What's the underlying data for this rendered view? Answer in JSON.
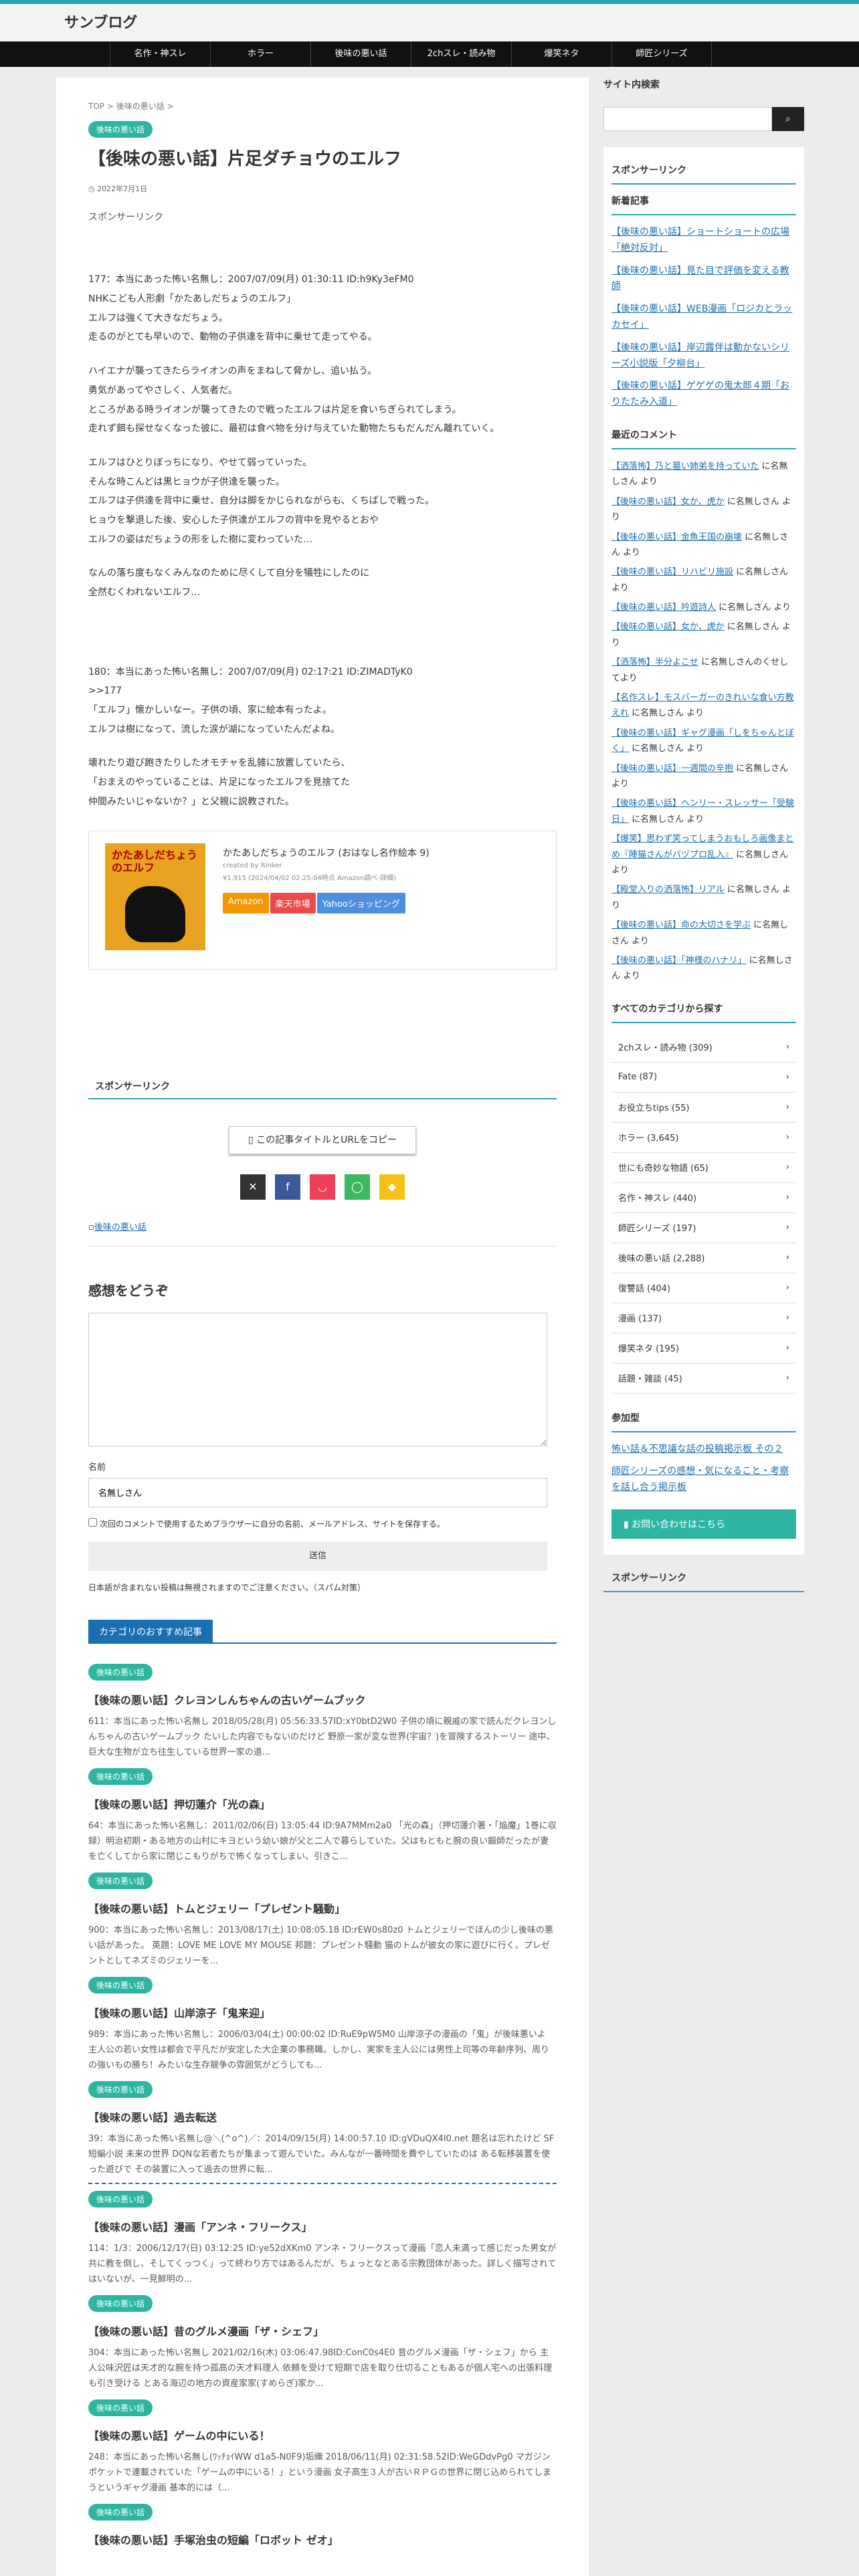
{
  "site": {
    "title": "サンブログ"
  },
  "nav": [
    "名作・神スレ",
    "ホラー",
    "後味の悪い話",
    "2chスレ・読み物",
    "爆笑ネタ",
    "師匠シリーズ"
  ],
  "breadcrumb": "TOP > 後味の悪い話 >",
  "category": "後味の悪い話",
  "post": {
    "title": "【後味の悪い話】片足ダチョウのエルフ",
    "date": "2022年7月1日",
    "sponsor": "スポンサーリンク",
    "blocks": [
      [
        "177：本当にあった怖い名無し：2007/07/09(月) 01:30:11 ID:h9Ky3eFM0",
        "NHKこども人形劇「かたあしだちょうのエルフ」",
        "エルフは強くて大きなだちょう。",
        "走るのがとても早いので、動物の子供達を背中に乗せて走ってやる。"
      ],
      [
        "ハイエナが襲ってきたらライオンの声をまねして脅かし、追い払う。",
        "勇気があってやさしく、人気者だ。",
        "ところがある時ライオンが襲ってきたので戦ったエルフは片足を食いちぎられてしまう。",
        "走れず餌も探せなくなった彼に、最初は食べ物を分け与えていた動物たちもだんだん離れていく。"
      ],
      [
        "エルフはひとりぼっちになり、やせて弱っていった。",
        "そんな時こんどは黒ヒョウが子供達を襲った。",
        "エルフは子供達を背中に乗せ、自分は脚をかじられながらも、くちばしで戦った。",
        "ヒョウを撃退した後、安心した子供達がエルフの背中を見やるとおや",
        "エルフの姿はだちょうの形をした樹に変わっていた…"
      ],
      [
        "なんの落ち度もなくみんなのために尽くして自分を犠牲にしたのに",
        "全然むくわれないエルフ…"
      ]
    ],
    "blocks2": [
      [
        "180：本当にあった怖い名無し：2007/07/09(月) 02:17:21 ID:ZIMADTyK0",
        ">>177",
        "「エルフ」懐かしいなー。子供の頃、家に絵本有ったよ。",
        "エルフは樹になって、流した涙が湖になっていたんだよね。"
      ],
      [
        "壊れたり遊び飽きたりしたオモチャを乱雑に放置していたら、",
        "「おまえのやっていることは、片足になったエルフを見捨てた",
        "仲間みたいじゃないか？」と父親に説教された。"
      ]
    ],
    "book": {
      "name": "かたあしだちょうのエルフ (おはなし名作絵本 9)",
      "author": "created by Rinker",
      "price": "¥1,915 (2024/04/02 02:25:04時点 Amazon調べ-詳細)",
      "cover_text": "かたあしだちょうのエルフ",
      "btn_amazon": "Amazon",
      "btn_rakuten": "楽天市場",
      "btn_yahoo": "Yahooショッピング"
    },
    "sponsor2": "スポンサーリンク",
    "copy_label": "この記事タイトルとURLをコピー",
    "tag": "後味の悪い話"
  },
  "comment": {
    "heading": "感想をどうぞ",
    "name_label": "名前",
    "name_value": "名無しさん",
    "save_label": "次回のコメントで使用するためブラウザーに自分の名前、メールアドレス、サイトを保存する。",
    "submit": "送信",
    "note": "日本語が含まれない投稿は無視されますのでご注意ください。（スパム対策）"
  },
  "reco": {
    "heading": "カテゴリのおすすめ記事",
    "items": [
      {
        "cat": "後味の悪い話",
        "title": "【後味の悪い話】クレヨンしんちゃんの古いゲームブック",
        "snippet": "611：本当にあった怖い名無し 2018/05/28(月) 05:56:33.57ID:xY0btD2W0 子供の頃に親戚の家で読んだクレヨンしんちゃんの古いゲームブック たいした内容でもないのだけど 野原一家が変な世界(宇宙？)を冒険するストーリー 途中、巨大な生物が立ち往生している世界一家の道..."
      },
      {
        "cat": "後味の悪い話",
        "title": "【後味の悪い話】押切蓮介「光の森」",
        "snippet": "64：本当にあった怖い名無し：2011/02/06(日) 13:05:44 ID:9A7MMm2a0 「光の森」（押切蓮介著・「焔魔」1巻に収録）明治初期・ある地方の山村にキヨという幼い娘が父と二人で暮らしていた。父はもともと腕の良い鍛師だったが妻を亡くしてから家に閉じこもりがちで怖くなってしまい、引きこ..."
      },
      {
        "cat": "後味の悪い話",
        "title": "【後味の悪い話】トムとジェリー「プレゼント騒動」",
        "snippet": "900：本当にあった怖い名無し：2013/08/17(土) 10:08:05.18 ID:rEW0s80z0 トムとジェリーでほんの少し後味の悪い話があった。 英題：LOVE ME LOVE MY MOUSE 邦題：プレゼント騒動 猫のトムが彼女の家に遊びに行く。プレゼントとしてネズミのジェリーを..."
      },
      {
        "cat": "後味の悪い話",
        "title": "【後味の悪い話】山岸涼子「鬼来迎」",
        "snippet": "989：本当にあった怖い名無し：2006/03/04(土) 00:00:02 ID:RuE9pW5M0 山岸涼子の漫画の「鬼」が後味悪いよ 主人公の若い女性は都会で平凡だが安定した大企業の事務職。しかし、実家を主人公には男性上司等の年齢序列、周りの強いもの勝ち！みたいな生存競争の雰囲気がどうしても..."
      },
      {
        "cat": "後味の悪い話",
        "title": "【後味の悪い話】過去転送",
        "snippet": "39：本当にあった怖い名無し@＼(^o^)／：2014/09/15(月) 14:00:57.10 ID:gVDuQX4I0.net 題名は忘れたけど SF短編小説 未来の世界 DQNな若者たちが集まって遊んでいた。みんなが一番時間を費やしていたのは ある転移装置を使った遊びで その装置に入って過去の世界に転..."
      },
      {
        "cat": "後味の悪い話",
        "title": "【後味の悪い話】漫画「アンネ・フリークス」",
        "snippet": "114：1/3：2006/12/17(日) 03:12:25 ID:ye52dXKm0 アンネ・フリークスって漫画「恋人未満って感じだった男女が共に教を倒し、そしてくっつく」って終わり方ではあるんだが、ちょっとなとある宗教団体があった。詳しく描写されてはいないが、一見鮮明の..."
      },
      {
        "cat": "後味の悪い話",
        "title": "【後味の悪い話】昔のグルメ漫画「ザ・シェフ」",
        "snippet": "304：本当にあった怖い名無し 2021/02/16(木) 03:06:47.98ID:ConC0s4E0 昔のグルメ漫画「ザ・シェフ」から 主人公味沢匠は天才的な腕を持つ孤高の天才料理人 依頼を受けて短期で店を取り仕切ることもあるが個人宅への出張料理も引き受ける とある海辺の地方の資産家家(すめらぎ)家か..."
      },
      {
        "cat": "後味の悪い話",
        "title": "【後味の悪い話】ゲームの中にいる！",
        "snippet": "248：本当にあった怖い名無し(ﾜｯﾁｮｲWW d1a5-N0F9)垢織 2018/06/11(月) 02:31:58.52ID:WeGDdvPg0 マガジンポケットで連載されていた「ゲームの中にいる！」という漫画 女子高生３人が古いＲＰＧの世界に閉じ込められてしまうというギャグ漫画 基本的には（..."
      },
      {
        "cat": "後味の悪い話",
        "title": "【後味の悪い話】手塚治虫の短編「ロボット ゼオ」",
        "snippet": ""
      }
    ]
  },
  "sidebar": {
    "search_title": "サイト内検索",
    "sponsor": "スポンサーリンク",
    "new_title": "新着記事",
    "new_items": [
      "【後味の悪い話】ショートショートの広場「絶対反対」",
      "【後味の悪い話】見た目で評価を変える教師",
      "【後味の悪い話】WEB漫画「ロジカとラッカセイ」",
      "【後味の悪い話】岸辺露伴は動かないシリーズ小説版「夕柳台」",
      "【後味の悪い話】ゲゲゲの鬼太郎４期「おりたたみ入道」"
    ],
    "comment_title": "最近のコメント",
    "comments": [
      {
        "link": "【洒落怖】乃と墓い姉弟を持っていた",
        "rest": " に名無しさん より"
      },
      {
        "link": "【後味の悪い話】女か、虎か",
        "rest": " に名無しさん より"
      },
      {
        "link": "【後味の悪い話】金魚王国の崩壊",
        "rest": " に名無しさん より"
      },
      {
        "link": "【後味の悪い話】リハビリ施設",
        "rest": " に名無しさん より"
      },
      {
        "link": "【後味の悪い話】吟遊詩人",
        "rest": " に名無しさん より"
      },
      {
        "link": "【後味の悪い話】女か、虎か",
        "rest": " に名無しさん より"
      },
      {
        "link": "【洒落怖】半分よこせ",
        "rest": " に名無しさんのくせしてより"
      },
      {
        "link": "【名作スレ】モスバーガーのきれいな食い方教えれ",
        "rest": " に名無しさん より"
      },
      {
        "link": "【後味の悪い話】ギャグ漫画「しをちゃんとぼく」",
        "rest": " に名無しさん より"
      },
      {
        "link": "【後味の悪い話】一週間の辛抱",
        "rest": " に名無しさん より"
      },
      {
        "link": "【後味の悪い話】ヘンリー・スレッサー「受験日」",
        "rest": " に名無しさん より"
      },
      {
        "link": "【爆笑】思わず笑ってしまうおもしろ画像まとめ『陣猫さんがバヅプロ乱入』",
        "rest": " に名無しさん より"
      },
      {
        "link": "【殿堂入りの洒落怖】リアル",
        "rest": " に名無しさん より"
      },
      {
        "link": "【後味の悪い話】命の大切さを学ぶ",
        "rest": " に名無しさん より"
      },
      {
        "link": "【後味の悪い話】「神様のハナリ」",
        "rest": " に名無しさん より"
      }
    ],
    "cats_title": "すべてのカテゴリから探す",
    "cats": [
      "2chスレ・読み物 (309)",
      "Fate (87)",
      "お役立ちtips (55)",
      "ホラー (3,645)",
      "世にも奇妙な物語 (65)",
      "名作・神スレ (440)",
      "師匠シリーズ (197)",
      "後味の悪い話 (2,288)",
      "復讐話 (404)",
      "漫画 (137)",
      "爆笑ネタ (195)",
      "話題・雑談 (45)"
    ],
    "join_title": "参加型",
    "join_items": [
      "怖い話＆不思議な話の投稿掲示板 その２",
      "師匠シリーズの感想・気になること・考察を話し合う掲示板"
    ],
    "contact": "お問い合わせはこちら",
    "sponsor_bottom": "スポンサーリンク"
  },
  "colors": {
    "accent": "#2aa4b5",
    "pill": "#2db5a0",
    "link": "#1a6fb0",
    "amazon": "#f39800",
    "rakuten": "#e94a4a",
    "yahoo": "#4c8fe0"
  },
  "icons": {
    "search": "search-icon",
    "share": [
      "x-icon",
      "facebook-icon",
      "pocket-icon",
      "line-icon",
      "feedly-icon"
    ]
  }
}
